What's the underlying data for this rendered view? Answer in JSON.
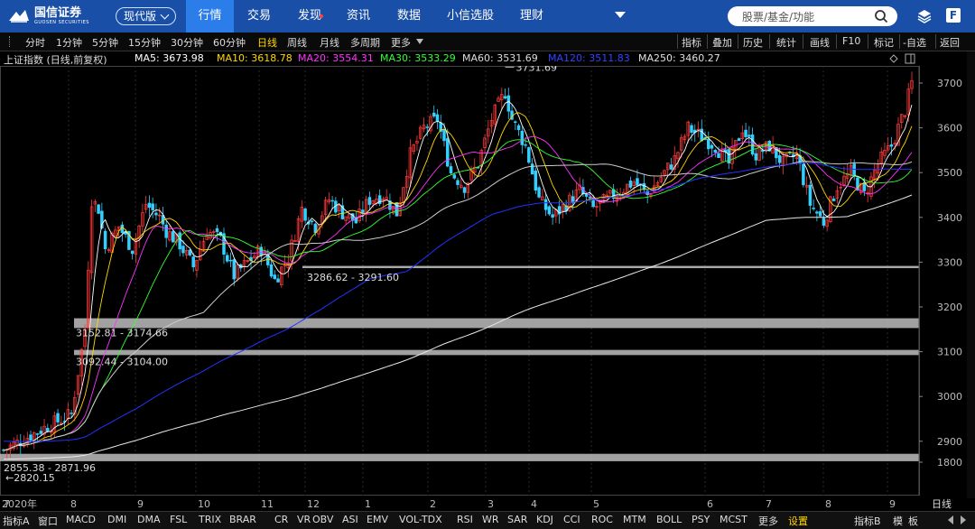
{
  "app": {
    "logo_name": "国信证券",
    "logo_sub": "GUOSEN SECURITIES",
    "edition": "现代版"
  },
  "nav": {
    "tabs": [
      {
        "label": "行情",
        "active": true
      },
      {
        "label": "交易",
        "active": false
      },
      {
        "label": "发现",
        "active": false,
        "dot": true
      },
      {
        "label": "资讯",
        "active": false
      },
      {
        "label": "数据",
        "active": false
      },
      {
        "label": "小信选股",
        "active": false
      },
      {
        "label": "理财",
        "active": false
      }
    ],
    "search_placeholder": "股票/基金/功能"
  },
  "toolbar": {
    "periods": [
      "分时",
      "1分钟",
      "5分钟",
      "15分钟",
      "30分钟",
      "60分钟",
      "日线",
      "周线",
      "月线",
      "多周期",
      "更多"
    ],
    "active_period": "日线",
    "tools": [
      "指标",
      "叠加",
      "历史",
      "统计",
      "画线",
      "F10",
      "标记",
      "-自选",
      "返回"
    ]
  },
  "chart": {
    "title": "上证指数 (日线,前复权)",
    "ma": [
      {
        "label": "MA5: 3673.98",
        "color": "#ffffff"
      },
      {
        "label": "MA10: 3618.78",
        "color": "#ffd700"
      },
      {
        "label": "MA20: 3554.31",
        "color": "#ff33ff"
      },
      {
        "label": "MA30: 3533.29",
        "color": "#33ff33"
      },
      {
        "label": "MA60: 3531.69",
        "color": "#dddddd"
      },
      {
        "label": "MA120: 3511.83",
        "color": "#3344ff"
      },
      {
        "label": "MA250: 3460.27",
        "color": "#e0e0e0"
      }
    ],
    "y_ticks": [
      "3700",
      "3600",
      "3500",
      "3400",
      "3300",
      "3200",
      "3100",
      "3000",
      "2900",
      "1800"
    ],
    "x_labels": [
      "2020年",
      "7",
      "8",
      "9",
      "10",
      "11",
      "12",
      "1",
      "2",
      "3",
      "4",
      "5",
      "6",
      "7",
      "8",
      "9"
    ],
    "period_label": "日线",
    "high_label": "3731.69",
    "low_label": "←2820.15",
    "zones": [
      "3286.62 - 3291.60",
      "3152.81 - 3174.66",
      "3092.44 - 3104.00",
      "2855.38 - 2871.96"
    ]
  },
  "chart_data": {
    "type": "candlestick",
    "title": "上证指数 (日线,前复权)",
    "y_range": [
      2820,
      3740
    ],
    "high": 3731.69,
    "low": 2820.15,
    "ma_latest": {
      "MA5": 3673.98,
      "MA10": 3618.78,
      "MA20": 3554.31,
      "MA30": 3533.29,
      "MA60": 3531.69,
      "MA120": 3511.83,
      "MA250": 3460.27
    },
    "support_zones": [
      [
        3286.62,
        3291.6
      ],
      [
        3152.81,
        3174.66
      ],
      [
        3092.44,
        3104.0
      ],
      [
        2855.38,
        2871.96
      ]
    ],
    "months": [
      "2020-06",
      "7",
      "8",
      "9",
      "10",
      "11",
      "12",
      "1",
      "2",
      "3",
      "4",
      "5",
      "6",
      "7",
      "8",
      "9"
    ],
    "close_path": [
      [
        0,
        2880
      ],
      [
        12,
        2930
      ],
      [
        20,
        2960
      ],
      [
        24,
        3150
      ],
      [
        26,
        3440
      ],
      [
        28,
        3420
      ],
      [
        30,
        3330
      ],
      [
        34,
        3380
      ],
      [
        38,
        3330
      ],
      [
        42,
        3430
      ],
      [
        46,
        3400
      ],
      [
        48,
        3370
      ],
      [
        52,
        3340
      ],
      [
        56,
        3290
      ],
      [
        60,
        3370
      ],
      [
        64,
        3350
      ],
      [
        68,
        3270
      ],
      [
        72,
        3300
      ],
      [
        76,
        3330
      ],
      [
        80,
        3260
      ],
      [
        84,
        3310
      ],
      [
        88,
        3420
      ],
      [
        92,
        3380
      ],
      [
        96,
        3440
      ],
      [
        100,
        3410
      ],
      [
        104,
        3390
      ],
      [
        108,
        3440
      ],
      [
        112,
        3450
      ],
      [
        116,
        3410
      ],
      [
        120,
        3540
      ],
      [
        124,
        3600
      ],
      [
        128,
        3620
      ],
      [
        132,
        3500
      ],
      [
        136,
        3470
      ],
      [
        140,
        3520
      ],
      [
        144,
        3620
      ],
      [
        148,
        3680
      ],
      [
        150,
        3620
      ],
      [
        154,
        3560
      ],
      [
        158,
        3440
      ],
      [
        162,
        3400
      ],
      [
        166,
        3430
      ],
      [
        170,
        3460
      ],
      [
        174,
        3420
      ],
      [
        178,
        3440
      ],
      [
        182,
        3460
      ],
      [
        186,
        3480
      ],
      [
        190,
        3450
      ],
      [
        194,
        3490
      ],
      [
        198,
        3530
      ],
      [
        202,
        3600
      ],
      [
        206,
        3580
      ],
      [
        210,
        3560
      ],
      [
        214,
        3520
      ],
      [
        218,
        3600
      ],
      [
        222,
        3540
      ],
      [
        226,
        3560
      ],
      [
        230,
        3520
      ],
      [
        234,
        3540
      ],
      [
        238,
        3430
      ],
      [
        242,
        3390
      ],
      [
        246,
        3470
      ],
      [
        250,
        3500
      ],
      [
        254,
        3450
      ],
      [
        258,
        3520
      ],
      [
        262,
        3560
      ],
      [
        266,
        3640
      ],
      [
        268,
        3700
      ]
    ]
  },
  "bottom": {
    "left": [
      "指标A",
      "窗口"
    ],
    "indicators": [
      "MACD",
      "DMI",
      "DMA",
      "FSL",
      "TRIX",
      "BRAR",
      "CR",
      "VR",
      "OBV",
      "ASI",
      "EMV",
      "VOL-TDX",
      "RSI",
      "WR",
      "SAR",
      "KDJ",
      "CCI",
      "ROC",
      "MTM",
      "BOLL",
      "PSY",
      "MCST",
      "更多"
    ],
    "settings": "设置",
    "right": [
      "指标B",
      "模",
      "板"
    ]
  }
}
